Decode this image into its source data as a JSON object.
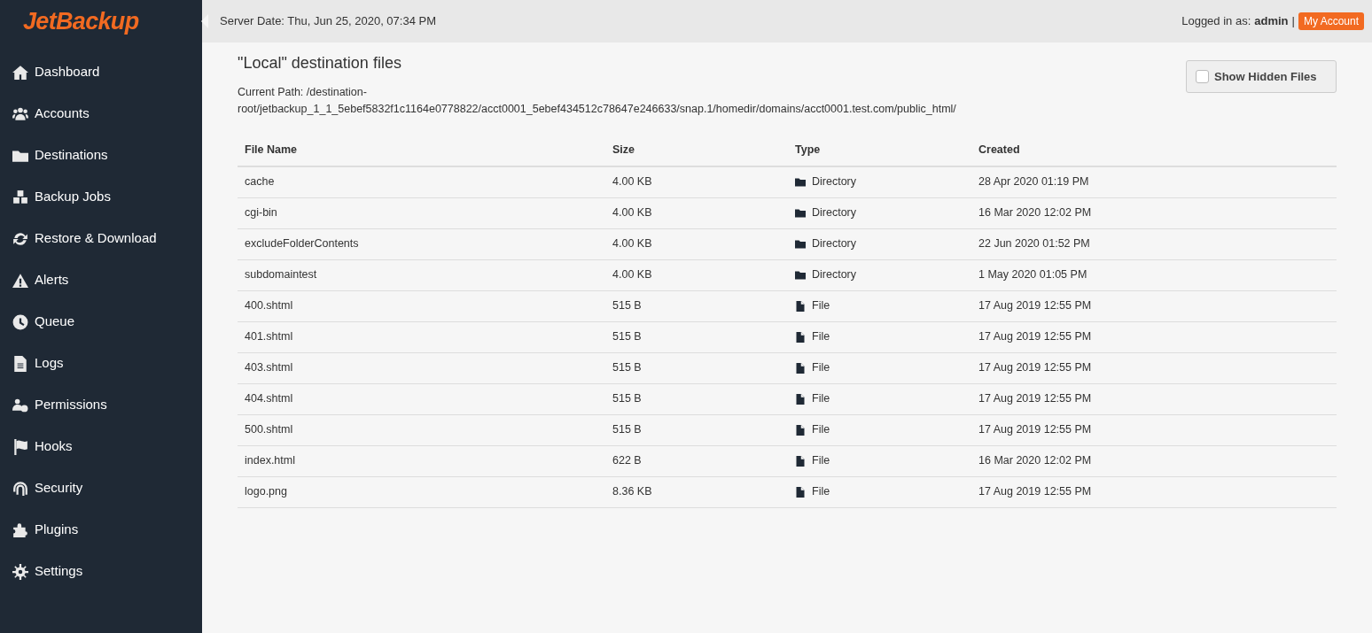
{
  "logo": "JetBackup",
  "sidebar": {
    "items": [
      {
        "label": "Dashboard"
      },
      {
        "label": "Accounts"
      },
      {
        "label": "Destinations"
      },
      {
        "label": "Backup Jobs"
      },
      {
        "label": "Restore & Download"
      },
      {
        "label": "Alerts"
      },
      {
        "label": "Queue"
      },
      {
        "label": "Logs"
      },
      {
        "label": "Permissions"
      },
      {
        "label": "Hooks"
      },
      {
        "label": "Security"
      },
      {
        "label": "Plugins"
      },
      {
        "label": "Settings"
      }
    ]
  },
  "header": {
    "server_date": "Server Date: Thu, Jun 25, 2020, 07:34 PM",
    "logged_in_label": "Logged in as:",
    "user": "admin",
    "separator": "|",
    "account_button": "My Account"
  },
  "page": {
    "title": "\"Local\" destination files",
    "current_path": "Current Path: /destination-root/jetbackup_1_1_5ebef5832f1c1164e0778822/acct0001_5ebef434512c78647e246633/snap.1/homedir/domains/acct0001.test.com/public_html/",
    "show_hidden": {
      "label": "Show Hidden Files",
      "checked": false
    }
  },
  "table": {
    "columns": [
      "File Name",
      "Size",
      "Type",
      "Created"
    ],
    "rows": [
      {
        "name": "cache",
        "size": "4.00 KB",
        "kind": "directory",
        "type": "Directory",
        "created": "28 Apr 2020 01:19 PM"
      },
      {
        "name": "cgi-bin",
        "size": "4.00 KB",
        "kind": "directory",
        "type": "Directory",
        "created": "16 Mar 2020 12:02 PM"
      },
      {
        "name": "excludeFolderContents",
        "size": "4.00 KB",
        "kind": "directory",
        "type": "Directory",
        "created": "22 Jun 2020 01:52 PM"
      },
      {
        "name": "subdomaintest",
        "size": "4.00 KB",
        "kind": "directory",
        "type": "Directory",
        "created": "1 May 2020 01:05 PM"
      },
      {
        "name": "400.shtml",
        "size": "515 B",
        "kind": "file",
        "type": "File",
        "created": "17 Aug 2019 12:55 PM"
      },
      {
        "name": "401.shtml",
        "size": "515 B",
        "kind": "file",
        "type": "File",
        "created": "17 Aug 2019 12:55 PM"
      },
      {
        "name": "403.shtml",
        "size": "515 B",
        "kind": "file",
        "type": "File",
        "created": "17 Aug 2019 12:55 PM"
      },
      {
        "name": "404.shtml",
        "size": "515 B",
        "kind": "file",
        "type": "File",
        "created": "17 Aug 2019 12:55 PM"
      },
      {
        "name": "500.shtml",
        "size": "515 B",
        "kind": "file",
        "type": "File",
        "created": "17 Aug 2019 12:55 PM"
      },
      {
        "name": "index.html",
        "size": "622 B",
        "kind": "file",
        "type": "File",
        "created": "16 Mar 2020 12:02 PM"
      },
      {
        "name": "logo.png",
        "size": "8.36 KB",
        "kind": "file",
        "type": "File",
        "created": "17 Aug 2019 12:55 PM"
      }
    ]
  }
}
